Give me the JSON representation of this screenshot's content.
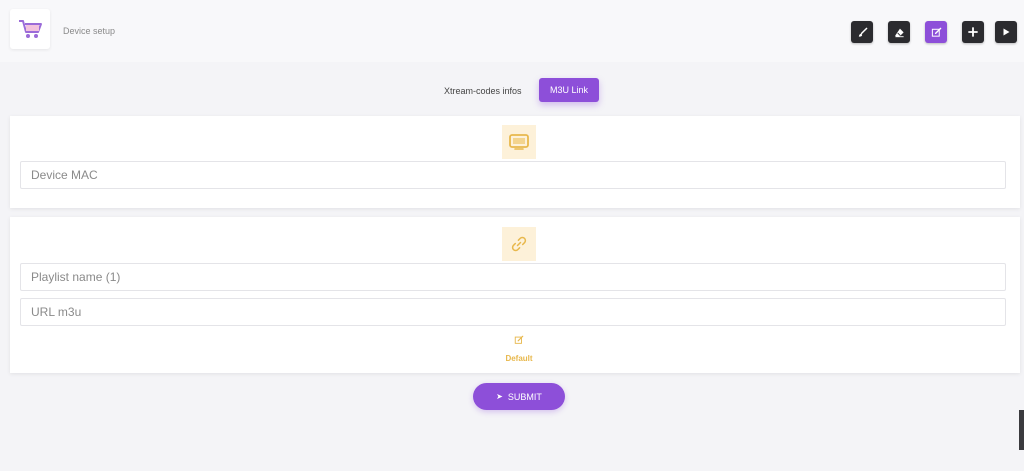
{
  "header": {
    "title": "Device setup",
    "logo_icon": "shopping-cart-icon",
    "toolbar": [
      {
        "icon": "brush-icon",
        "active": false
      },
      {
        "icon": "eraser-icon",
        "active": false
      },
      {
        "icon": "edit-icon",
        "active": true
      },
      {
        "icon": "plus-icon",
        "active": false
      },
      {
        "icon": "play-icon",
        "active": false
      }
    ]
  },
  "tabs": [
    {
      "label": "Xtream-codes infos",
      "active": false
    },
    {
      "label": "M3U Link",
      "active": true
    }
  ],
  "device_card": {
    "icon": "monitor-icon",
    "mac_placeholder": "Device MAC"
  },
  "playlist_card": {
    "icon": "link-icon",
    "name_placeholder": "Playlist name (1)",
    "url_placeholder": "URL m3u",
    "default_icon": "edit-icon",
    "default_label": "Default"
  },
  "submit": {
    "label": "SUBMIT",
    "arrow": "➤"
  },
  "colors": {
    "accent": "#8d4fd9",
    "dark_button": "#2b2b2f",
    "icon_tile": "#fdf1d9",
    "gold": "#e8b84c"
  }
}
